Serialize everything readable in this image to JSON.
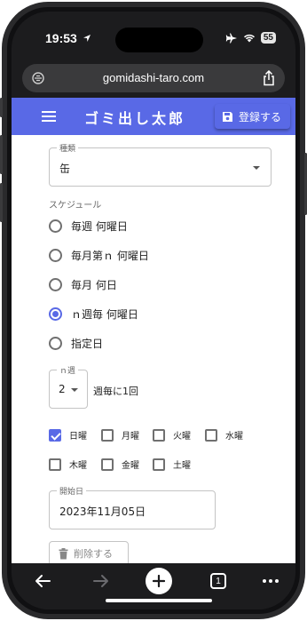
{
  "statusbar": {
    "time": "19:53",
    "battery": "55"
  },
  "browser": {
    "url": "gomidashi-taro.com"
  },
  "appbar": {
    "title": "ゴミ出し太郎",
    "register_label": "登録する"
  },
  "form": {
    "type_field": {
      "label": "種類",
      "value": "缶"
    },
    "schedule": {
      "label": "スケジュール",
      "options": [
        {
          "label": "毎週 何曜日",
          "checked": false
        },
        {
          "label": "毎月第ｎ 何曜日",
          "checked": false
        },
        {
          "label": "毎月 何日",
          "checked": false
        },
        {
          "label": "ｎ週毎 何曜日",
          "checked": true
        },
        {
          "label": "指定日",
          "checked": false
        }
      ]
    },
    "n_week": {
      "label": "ｎ週",
      "value": "2",
      "suffix_text": "週毎に1回"
    },
    "weekdays": [
      {
        "label": "日曜",
        "checked": true
      },
      {
        "label": "月曜",
        "checked": false
      },
      {
        "label": "火曜",
        "checked": false
      },
      {
        "label": "水曜",
        "checked": false
      },
      {
        "label": "木曜",
        "checked": false
      },
      {
        "label": "金曜",
        "checked": false
      },
      {
        "label": "土曜",
        "checked": false
      }
    ],
    "start_date": {
      "label": "開始日",
      "value": "2023年11月05日"
    },
    "delete_label": "削除する"
  },
  "toolbar": {
    "tab_count": "1"
  },
  "colors": {
    "accent": "#5969e6",
    "frame": "#1c1c1e",
    "field_border": "#c4c4c4"
  }
}
